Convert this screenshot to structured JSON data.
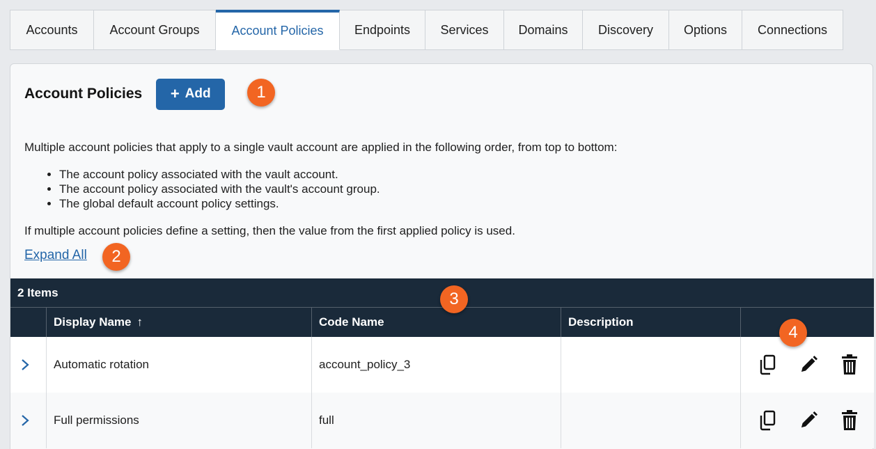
{
  "tabs": [
    {
      "label": "Accounts",
      "active": false
    },
    {
      "label": "Account Groups",
      "active": false
    },
    {
      "label": "Account Policies",
      "active": true
    },
    {
      "label": "Endpoints",
      "active": false
    },
    {
      "label": "Services",
      "active": false
    },
    {
      "label": "Domains",
      "active": false
    },
    {
      "label": "Discovery",
      "active": false
    },
    {
      "label": "Options",
      "active": false
    },
    {
      "label": "Connections",
      "active": false
    }
  ],
  "header": {
    "title": "Account Policies",
    "add_label": "Add"
  },
  "callouts": [
    "1",
    "2",
    "3",
    "4"
  ],
  "intro": "Multiple account policies that apply to a single vault account are applied in the following order, from top to bottom:",
  "order_rules": [
    "The account policy associated with the vault account.",
    "The account policy associated with the vault's account group.",
    "The global default account policy settings."
  ],
  "note": "If multiple account policies define a setting, then the value from the first applied policy is used.",
  "expand_label": "Expand All",
  "grid": {
    "count_label": "2 Items",
    "columns": [
      "Display Name",
      "Code Name",
      "Description"
    ],
    "rows": [
      {
        "display_name": "Automatic rotation",
        "code_name": "account_policy_3",
        "description": ""
      },
      {
        "display_name": "Full permissions",
        "code_name": "full",
        "description": ""
      }
    ]
  },
  "colors": {
    "accent": "#2466a8",
    "header_bg": "#1a2a3a",
    "callout": "#f26522"
  },
  "icons": {
    "copy": "copy-icon",
    "edit": "pencil-icon",
    "delete": "trash-icon",
    "expand": "chevron-right-icon",
    "sort": "sort-ascending-icon"
  }
}
